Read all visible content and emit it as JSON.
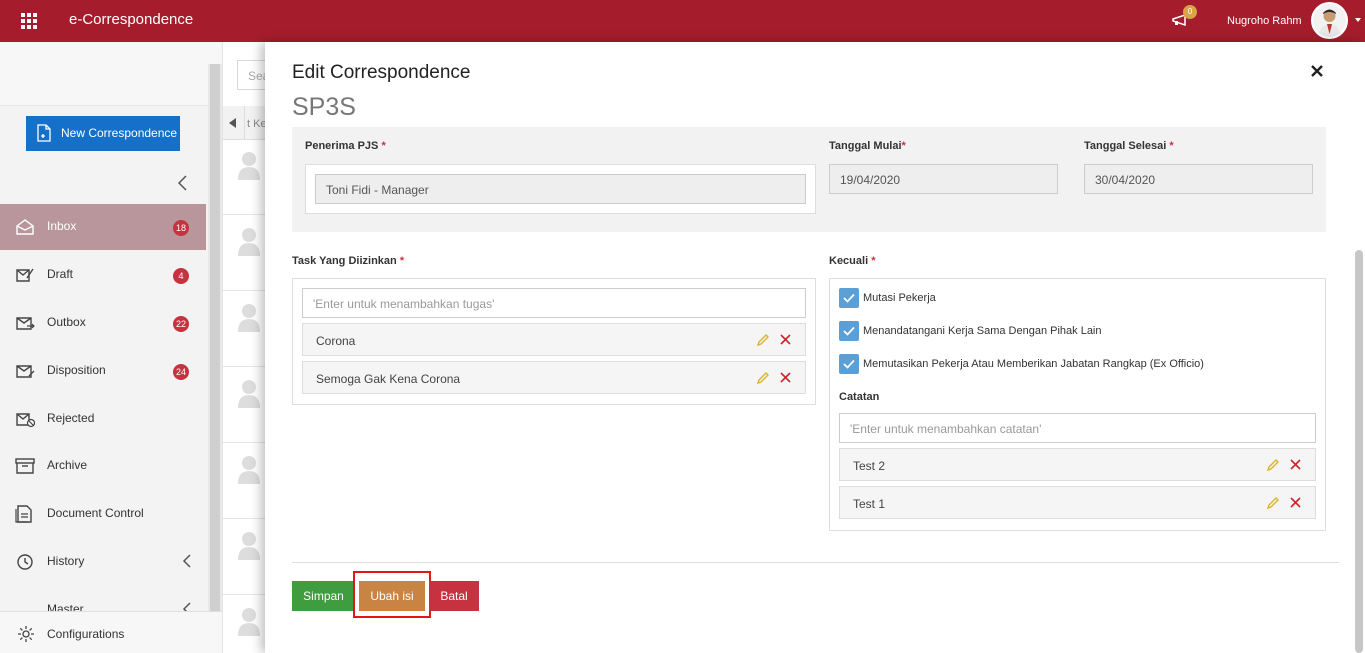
{
  "app": {
    "title": "e-Correspondence"
  },
  "header": {
    "notification_count": "0",
    "user_name": "Nugroho Rahm"
  },
  "sidebar": {
    "new_button_label": "New Correspondence",
    "items": [
      {
        "label": "Inbox",
        "badge": "18",
        "icon": "inbox-icon",
        "active": true
      },
      {
        "label": "Draft",
        "badge": "4",
        "icon": "draft-icon"
      },
      {
        "label": "Outbox",
        "badge": "22",
        "icon": "outbox-icon"
      },
      {
        "label": "Disposition",
        "badge": "24",
        "icon": "disposition-icon"
      },
      {
        "label": "Rejected",
        "icon": "rejected-icon"
      },
      {
        "label": "Archive",
        "icon": "archive-icon"
      },
      {
        "label": "Document Control",
        "icon": "document-control-icon"
      },
      {
        "label": "History",
        "icon": "history-icon"
      },
      {
        "label": "Master",
        "icon": "master-icon"
      }
    ],
    "configurations_label": "Configurations"
  },
  "list": {
    "search_placeholder": "Sea",
    "column_header": "t Ke"
  },
  "modal": {
    "title": "Edit Correspondence",
    "subtitle": "SP3S",
    "penerima_label": "Penerima PJS",
    "penerima_value": "Toni Fidi - Manager",
    "tanggal_mulai_label": "Tanggal Mulai",
    "tanggal_mulai_value": "19/04/2020",
    "tanggal_selesai_label": "Tanggal Selesai",
    "tanggal_selesai_value": "30/04/2020",
    "task_label": "Task Yang Diizinkan",
    "task_placeholder": "'Enter untuk menambahkan tugas'",
    "tasks": [
      "Corona",
      "Semoga Gak Kena Corona"
    ],
    "kecuali_label": "Kecuali",
    "kecuali_items": [
      {
        "label": "Mutasi Pekerja",
        "checked": true
      },
      {
        "label": "Menandatangani Kerja Sama Dengan Pihak Lain",
        "checked": true
      },
      {
        "label": "Memutasikan Pekerja Atau Memberikan Jabatan Rangkap (Ex Officio)",
        "checked": true
      }
    ],
    "catatan_label": "Catatan",
    "catatan_placeholder": "'Enter untuk menambahkan catatan'",
    "notes": [
      "Test 2",
      "Test 1"
    ],
    "required_mark": "*",
    "buttons": {
      "save": "Simpan",
      "edit": "Ubah isi",
      "cancel": "Batal"
    }
  },
  "colors": {
    "brand": "#a51d2d",
    "primary": "#1570c9",
    "success": "#3f9d3f",
    "warning": "#c98342",
    "danger": "#c6323f"
  }
}
